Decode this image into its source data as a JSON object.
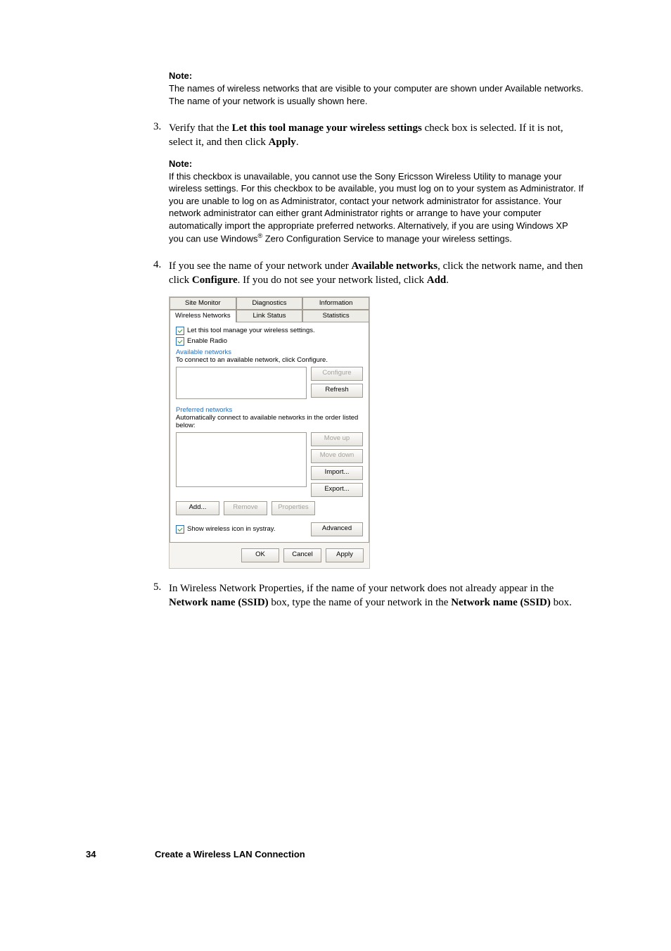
{
  "note1": {
    "heading": "Note:",
    "body": "The names of wireless networks that are visible to your computer are shown under Available networks. The name of your network is usually shown here."
  },
  "step3": {
    "num": "3.",
    "prefix": "Verify that the ",
    "bold1": "Let this tool manage your wireless settings",
    "mid": " check box is selected. If it is not, select it, and then click ",
    "bold2": "Apply",
    "suffix": "."
  },
  "note2": {
    "heading": "Note:",
    "body_a": "If this checkbox is unavailable, you cannot use the Sony Ericsson Wireless Utility to manage your wireless settings. For this checkbox to be available, you must log on to your system as Administrator. If you are unable to log on as Administrator, contact your network administrator for assistance. Your network administrator can either grant Administrator rights or arrange to have your computer automatically import the appropriate preferred networks. Alternatively, if you are using Windows XP you can use Windows",
    "reg": "®",
    "body_b": " Zero Configuration Service to manage your wireless settings."
  },
  "step4": {
    "num": "4.",
    "prefix": "If you see the name of your network under ",
    "bold1": "Available networks",
    "mid1": ", click the network name, and then click ",
    "bold2": "Configure",
    "mid2": ". If you do not see your network listed, click ",
    "bold3": "Add",
    "suffix": "."
  },
  "dialog": {
    "tabs_back": [
      "Site Monitor",
      "Diagnostics",
      "Information"
    ],
    "tabs_front": [
      "Wireless Networks",
      "Link Status",
      "Statistics"
    ],
    "chk_manage": "Let this tool manage your wireless settings.",
    "chk_radio": "Enable Radio",
    "avail_title": "Available networks",
    "avail_sub": "To connect to an available network, click Configure.",
    "btn_configure": "Configure",
    "btn_refresh": "Refresh",
    "pref_title": "Preferred networks",
    "pref_sub": "Automatically connect to available networks in the order listed below:",
    "btn_moveup": "Move up",
    "btn_movedown": "Move down",
    "btn_import": "Import...",
    "btn_export": "Export...",
    "btn_add": "Add...",
    "btn_remove": "Remove",
    "btn_properties": "Properties",
    "chk_systray": "Show wireless icon in systray.",
    "btn_advanced": "Advanced",
    "btn_ok": "OK",
    "btn_cancel": "Cancel",
    "btn_apply": "Apply"
  },
  "step5": {
    "num": "5.",
    "prefix": "In Wireless Network Properties, if the name of your network does not already appear in the ",
    "bold1": "Network name (SSID)",
    "mid": " box, type the name of your network in the ",
    "bold2": "Network name (SSID)",
    "suffix": " box."
  },
  "footer": {
    "page": "34",
    "title": "Create a Wireless LAN Connection"
  }
}
